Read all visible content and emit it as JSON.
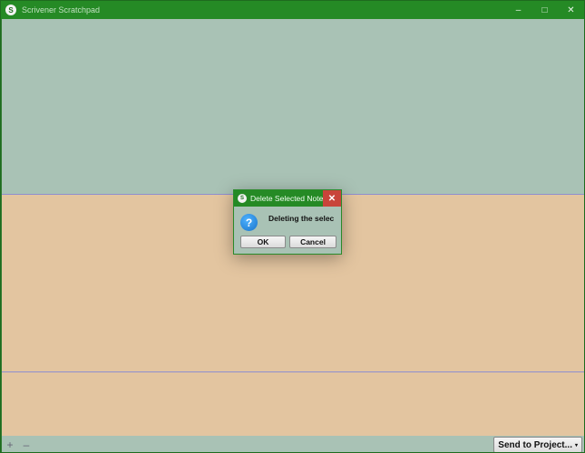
{
  "window": {
    "title": "Scrivener Scratchpad",
    "controls": {
      "minimize": "–",
      "maximize": "□",
      "close": "✕"
    }
  },
  "footer": {
    "add": "+",
    "remove": "–",
    "send_label": "Send to Project...",
    "send_caret": "▾",
    "icons": [
      "camera-icon"
    ]
  },
  "dialog": {
    "title": "Delete Selected Note?",
    "close": "✕",
    "message": "Deleting the selec",
    "icon_glyph": "?",
    "ok_label": "OK",
    "cancel_label": "Cancel"
  },
  "colors": {
    "titlebar": "#258a25",
    "top_pane": "#a9c2b5",
    "notes_pane": "#e3c5a0",
    "close_red": "#c8443a"
  }
}
